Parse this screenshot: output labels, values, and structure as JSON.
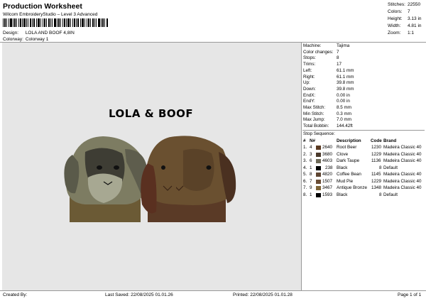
{
  "header": {
    "title": "Production Worksheet",
    "subtitle": "Wilcom EmbroideryStudio – Level 3 Advanced",
    "design_label": "Design:",
    "design_value": "LOLA AND BOOF 4,8IN",
    "colorway_label": "Colorway:",
    "colorway_value": "Colorway 1"
  },
  "summary": {
    "stitches_label": "Stitches:",
    "stitches": "22550",
    "colors_label": "Colors:",
    "colors": "7",
    "height_label": "Height:",
    "height": "3.13 in",
    "width_label": "Width:",
    "width": "4.81 in",
    "zoom_label": "Zoom:",
    "zoom": "1:1"
  },
  "design": {
    "caption": "LOLA & BOOF"
  },
  "machine_info": [
    {
      "label": "Machine:",
      "value": "Tajima"
    },
    {
      "label": "Color changes:",
      "value": "7"
    },
    {
      "label": "Stops:",
      "value": "8"
    },
    {
      "label": "Trims:",
      "value": "17"
    },
    {
      "label": "Left:",
      "value": "61.1 mm"
    },
    {
      "label": "Right:",
      "value": "61.1 mm"
    },
    {
      "label": "Up:",
      "value": "39.8 mm"
    },
    {
      "label": "Down:",
      "value": "39.8 mm"
    },
    {
      "label": "EndX:",
      "value": "0.00 in"
    },
    {
      "label": "EndY:",
      "value": "0.00 in"
    },
    {
      "label": "Max Stitch:",
      "value": "8.5 mm"
    },
    {
      "label": "Min Stitch:",
      "value": "0.3 mm"
    },
    {
      "label": "Max Jump:",
      "value": "7.0 mm"
    },
    {
      "label": "Total Bobbin:",
      "value": "144.42ft"
    }
  ],
  "stop_sequence": {
    "title": "Stop Sequence:",
    "headers": {
      "index": "#",
      "needle": "N#",
      "description": "Description",
      "code": "Code",
      "brand": "Brand"
    },
    "rows": [
      {
        "idx": "1.",
        "n": "4",
        "num": "2640",
        "desc": "Root Beer",
        "code": "1230",
        "brand": "Madeira Classic 40",
        "color": "#5a3a22"
      },
      {
        "idx": "2.",
        "n": "3",
        "num": "3680",
        "desc": "Clove",
        "code": "1229",
        "brand": "Madeira Classic 40",
        "color": "#4a3a2c"
      },
      {
        "idx": "3.",
        "n": "6",
        "num": "4603",
        "desc": "Dark Taupe",
        "code": "1136",
        "brand": "Madeira Classic 40",
        "color": "#6e6a58"
      },
      {
        "idx": "4.",
        "n": "1",
        "num": "238",
        "desc": "Black",
        "code": "8",
        "brand": "Default",
        "color": "#000000"
      },
      {
        "idx": "5.",
        "n": "8",
        "num": "4820",
        "desc": "Coffee Bean",
        "code": "1145",
        "brand": "Madeira Classic 40",
        "color": "#5e4632"
      },
      {
        "idx": "6.",
        "n": "7",
        "num": "1507",
        "desc": "Mud Pie",
        "code": "1229",
        "brand": "Madeira Classic 40",
        "color": "#6a4e36"
      },
      {
        "idx": "7.",
        "n": "9",
        "num": "3467",
        "desc": "Antique Bronze",
        "code": "1348",
        "brand": "Madeira Classic 40",
        "color": "#7e6438"
      },
      {
        "idx": "8.",
        "n": "1",
        "num": "1593",
        "desc": "Black",
        "code": "8",
        "brand": "Default",
        "color": "#000000"
      }
    ]
  },
  "footer": {
    "created_by": "Created By:",
    "last_saved": "Last Saved: 22/08/2025 01.01.26",
    "printed": "Printed: 22/08/2025 01.01.28",
    "page": "Page 1 of 1"
  }
}
